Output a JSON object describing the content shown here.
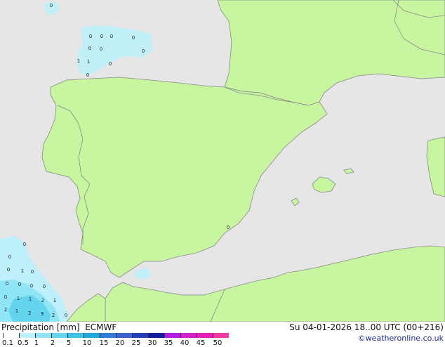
{
  "map": {
    "title": "Precipitation [mm]",
    "model": "ECMWF",
    "valid_time": "Su 04-01-2026 18..00 UTC (00+216)",
    "credit": "©weatheronline.co.uk",
    "colors": {
      "sea": "#e6e6e6",
      "land": "#c8f5a0",
      "border": "#888888"
    },
    "precip_labels": [
      "0",
      "0",
      "0",
      "0",
      "0",
      "0",
      "0",
      "1",
      "1",
      "0",
      "0",
      "0",
      "0",
      "0",
      "0",
      "0",
      "1",
      "0",
      "0",
      "0",
      "0",
      "0",
      "0",
      "1",
      "1",
      "2",
      "1",
      "2",
      "1",
      "3",
      "3",
      "2",
      "0"
    ],
    "legend": {
      "ticks": [
        "0.1",
        "0.5",
        "1",
        "2",
        "5",
        "10",
        "15",
        "20",
        "25",
        "30",
        "35",
        "40",
        "45",
        "50"
      ],
      "colors": [
        "#ffffff",
        "#bdf0fa",
        "#8fe4f5",
        "#63d5ee",
        "#3cc2e6",
        "#1ea8de",
        "#2b7fd8",
        "#3d5fd0",
        "#2540b8",
        "#121d9e",
        "#b41de0",
        "#d21fd0",
        "#e21fb8",
        "#f03aa0"
      ]
    }
  }
}
